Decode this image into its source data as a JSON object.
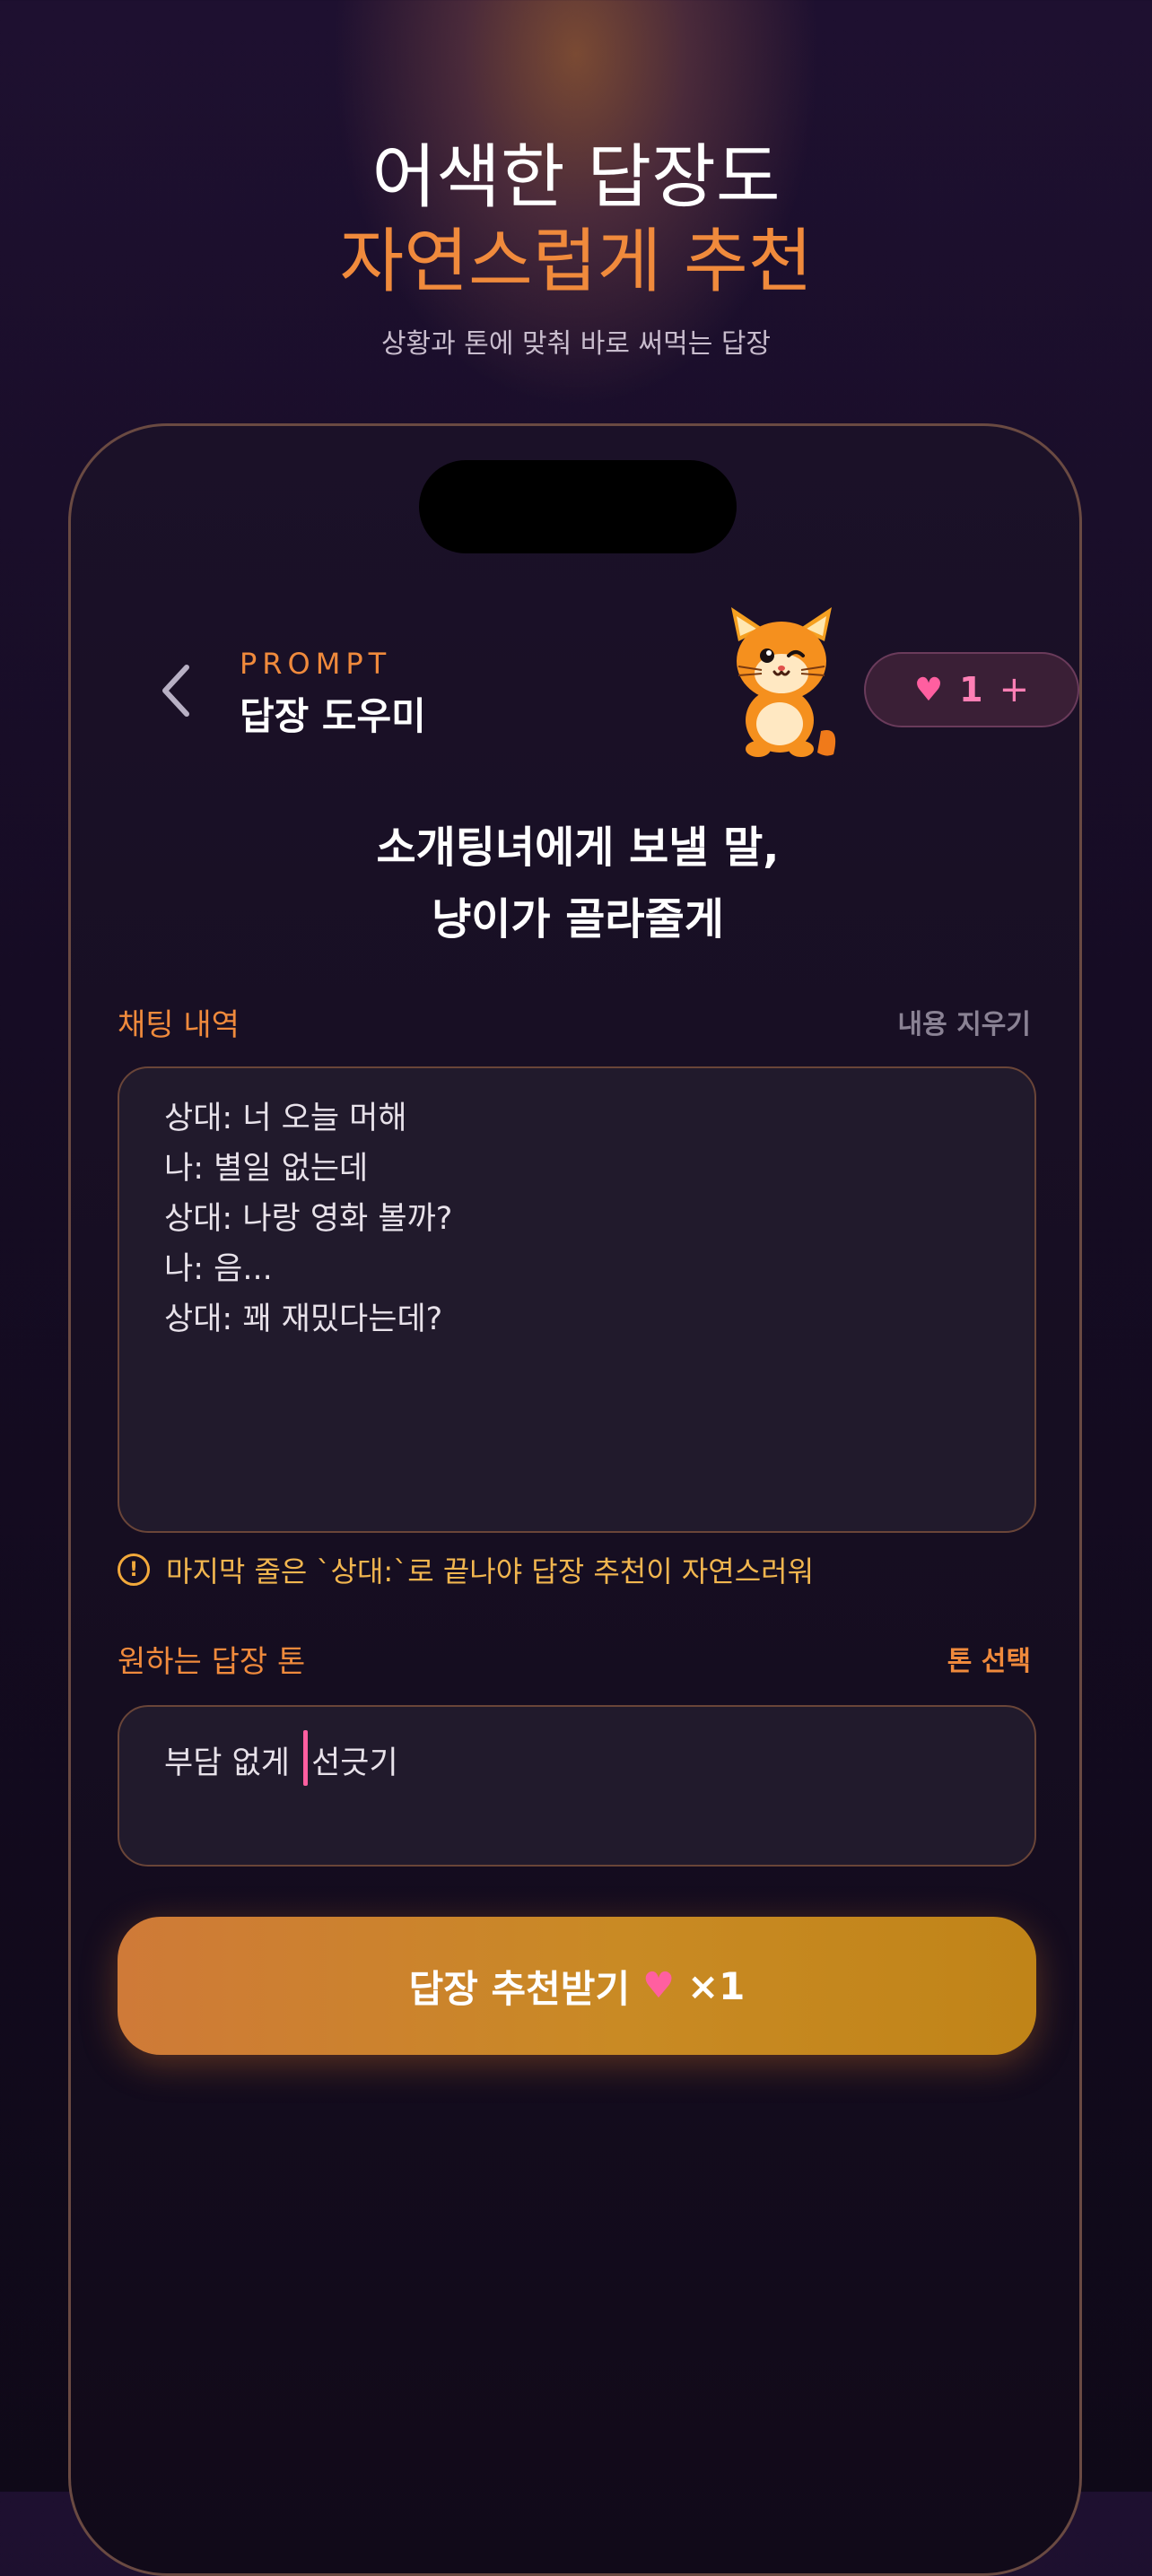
{
  "hero": {
    "line1": "어색한 답장도",
    "line2": "자연스럽게 추천",
    "subtitle": "상황과 톤에 맞춰 바로 써먹는 답장"
  },
  "header": {
    "eyebrow": "PROMPT",
    "title": "답장 도우미",
    "hearts": {
      "icon": "heart-icon",
      "count": "1",
      "plus": "+"
    }
  },
  "headline": {
    "line1": "소개팅녀에게 보낼 말,",
    "line2": "냥이가 골라줄게"
  },
  "chat": {
    "label": "채팅 내역",
    "clear_label": "내용 지우기",
    "lines": [
      "상대: 너 오늘 머해",
      "나: 별일 없는데",
      "상대: 나랑 영화 볼까?",
      "나: 음...",
      "상대: 꽤 재밌다는데?"
    ],
    "warning": "마지막 줄은 `상대:`로 끝나야 답장 추천이 자연스러워"
  },
  "tone": {
    "label": "원하는 답장 톤",
    "select_label": "톤 선택",
    "value_before_cursor": "부담 없게 ",
    "value_after_cursor": "선긋기"
  },
  "cta": {
    "label": "답장 추천받기",
    "multiplier": "×1"
  },
  "colors": {
    "accent": "#f08a3c",
    "heart": "#ff5fa0",
    "warning": "#f2a93b",
    "background": "#160c24"
  }
}
